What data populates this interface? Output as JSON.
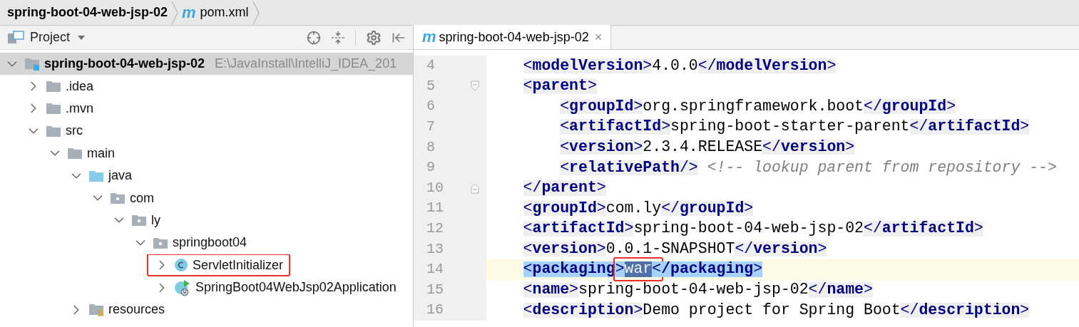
{
  "breadcrumbs": [
    {
      "label": "spring-boot-04-web-jsp-02",
      "bold": true
    },
    {
      "label": "pom.xml",
      "bold": false,
      "icon": "m"
    }
  ],
  "project_panel": {
    "title": "Project",
    "tree": [
      {
        "label": "spring-boot-04-web-jsp-02",
        "kind": "module",
        "path": "E:\\JavaInstall\\IntelliJ_IDEA_201",
        "selected": true,
        "expanded": true,
        "children": [
          {
            "label": ".idea",
            "kind": "folder",
            "selected": false,
            "expanded": false
          },
          {
            "label": ".mvn",
            "kind": "folder",
            "selected": false,
            "expanded": false
          },
          {
            "label": "src",
            "kind": "folder",
            "selected": false,
            "expanded": true,
            "children": [
              {
                "label": "main",
                "kind": "folder",
                "selected": false,
                "expanded": true,
                "children": [
                  {
                    "label": "java",
                    "kind": "source-folder",
                    "selected": false,
                    "expanded": true,
                    "children": [
                      {
                        "label": "com",
                        "kind": "package",
                        "selected": false,
                        "expanded": true,
                        "children": [
                          {
                            "label": "ly",
                            "kind": "package",
                            "selected": false,
                            "expanded": true,
                            "children": [
                              {
                                "label": "springboot04",
                                "kind": "package",
                                "selected": false,
                                "expanded": true,
                                "children": [
                                  {
                                    "label": "ServletInitializer",
                                    "kind": "class",
                                    "selected": false,
                                    "expanded": false,
                                    "annotated": true
                                  },
                                  {
                                    "label": "SpringBoot04WebJsp02Application",
                                    "kind": "app-class",
                                    "selected": false,
                                    "expanded": false
                                  }
                                ]
                              }
                            ]
                          }
                        ]
                      }
                    ]
                  },
                  {
                    "label": "resources",
                    "kind": "resources",
                    "selected": false,
                    "expanded": false
                  }
                ]
              }
            ]
          }
        ]
      }
    ]
  },
  "editor": {
    "tab": {
      "icon": "m",
      "label": "spring-boot-04-web-jsp-02",
      "close": "×"
    },
    "lines": [
      {
        "number": "4",
        "current": false,
        "tokens": [
          {
            "kind": "tag",
            "text": "<modelVersion>"
          },
          {
            "kind": "text",
            "text": "4.0.0"
          },
          {
            "kind": "tag",
            "text": "</modelVersion>"
          }
        ]
      },
      {
        "number": "5",
        "current": false,
        "tokens": [
          {
            "kind": "tag",
            "text": "<parent>"
          }
        ],
        "children": [
          {
            "number": "6",
            "current": false,
            "tokens": [
              {
                "kind": "tag",
                "text": "<groupId>"
              },
              {
                "kind": "text",
                "text": "org.springframework.boot"
              },
              {
                "kind": "tag",
                "text": "</groupId>"
              }
            ]
          },
          {
            "number": "7",
            "current": false,
            "tokens": [
              {
                "kind": "tag",
                "text": "<artifactId>"
              },
              {
                "kind": "text",
                "text": "spring-boot-starter-parent"
              },
              {
                "kind": "tag",
                "text": "</artifactId>"
              }
            ]
          },
          {
            "number": "8",
            "current": false,
            "tokens": [
              {
                "kind": "tag",
                "text": "<version>"
              },
              {
                "kind": "text",
                "text": "2.3.4.RELEASE"
              },
              {
                "kind": "tag",
                "text": "</version>"
              }
            ]
          },
          {
            "number": "9",
            "current": false,
            "tokens": [
              {
                "kind": "tag",
                "text": "<relativePath/>"
              },
              {
                "kind": "comment",
                "text": "<!-- lookup parent from repository -->"
              }
            ]
          }
        ]
      },
      {
        "number": "10",
        "current": false,
        "tokens": [
          {
            "kind": "tag",
            "text": "</parent>"
          }
        ]
      },
      {
        "number": "11",
        "current": false,
        "tokens": [
          {
            "kind": "tag",
            "text": "<groupId>"
          },
          {
            "kind": "text",
            "text": "com.ly"
          },
          {
            "kind": "tag",
            "text": "</groupId>"
          }
        ]
      },
      {
        "number": "12",
        "current": false,
        "tokens": [
          {
            "kind": "tag",
            "text": "<artifactId>"
          },
          {
            "kind": "text",
            "text": "spring-boot-04-web-jsp-02"
          },
          {
            "kind": "tag",
            "text": "</artifactId>"
          }
        ]
      },
      {
        "number": "13",
        "current": false,
        "tokens": [
          {
            "kind": "tag",
            "text": "<version>"
          },
          {
            "kind": "text",
            "text": "0.0.1-SNAPSHOT"
          },
          {
            "kind": "tag",
            "text": "</version>"
          }
        ]
      },
      {
        "number": "14",
        "current": true,
        "tokens": [
          {
            "kind": "tag",
            "text": "<packaging",
            "selected": true
          },
          {
            "kind": "tag",
            "text": ">",
            "selected": true,
            "boxed": true
          },
          {
            "kind": "text",
            "text": "war",
            "selected": true,
            "boxed": true
          },
          {
            "kind": "tag",
            "text": "<",
            "selected": true,
            "boxed": true
          },
          {
            "kind": "tag",
            "text": "/packaging>",
            "selected": true
          }
        ]
      },
      {
        "number": "15",
        "current": false,
        "tokens": [
          {
            "kind": "tag",
            "text": "<name>"
          },
          {
            "kind": "text",
            "text": "spring-boot-04-web-jsp-02"
          },
          {
            "kind": "tag",
            "text": "</name>"
          }
        ]
      },
      {
        "number": "16",
        "current": false,
        "tokens": [
          {
            "kind": "tag",
            "text": "<description>"
          },
          {
            "kind": "text",
            "text": "Demo project for Spring Boot"
          },
          {
            "kind": "tag",
            "text": "</description>"
          }
        ]
      }
    ]
  }
}
